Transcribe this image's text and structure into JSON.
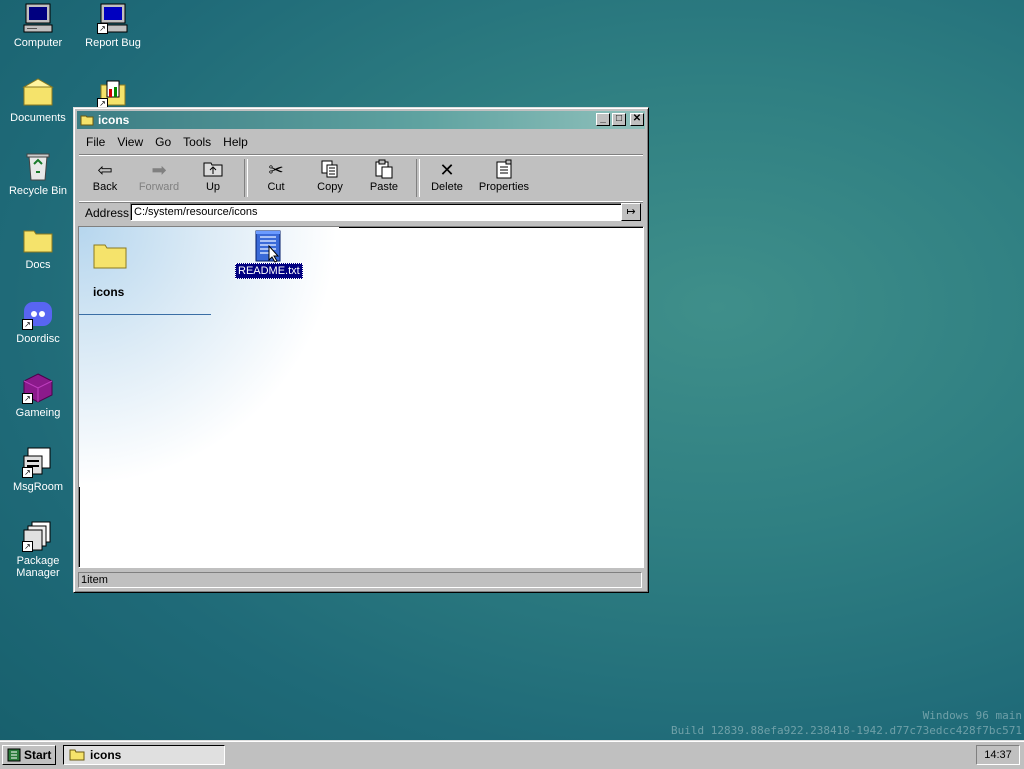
{
  "desktop": {
    "icons": [
      {
        "label": "Computer",
        "icon": "computer-icon"
      },
      {
        "label": "Report Bug",
        "icon": "report-bug-icon"
      },
      {
        "label": "Documents",
        "icon": "documents-folder-icon"
      },
      {
        "label": "",
        "icon": "setup-program-icon"
      },
      {
        "label": "Recycle Bin",
        "icon": "recycle-bin-icon"
      },
      {
        "label": "Docs",
        "icon": "folder-icon"
      },
      {
        "label": "Doordisc",
        "icon": "doordisc-icon"
      },
      {
        "label": "Gameing",
        "icon": "gameing-icon"
      },
      {
        "label": "MsgRoom",
        "icon": "msgroom-icon"
      },
      {
        "label": "Package Manager",
        "icon": "package-manager-icon"
      }
    ]
  },
  "window": {
    "title": "icons",
    "controls": {
      "minimize": "_",
      "maximize": "□",
      "close": "✕"
    },
    "menu": [
      "File",
      "View",
      "Go",
      "Tools",
      "Help"
    ],
    "toolbar": {
      "back": "Back",
      "forward": "Forward",
      "up": "Up",
      "cut": "Cut",
      "copy": "Copy",
      "paste": "Paste",
      "delete": "Delete",
      "properties": "Properties"
    },
    "address": {
      "label": "Address",
      "value": "C:/system/resource/icons"
    },
    "side_panel": {
      "title": "icons"
    },
    "files": [
      {
        "name": "README.txt",
        "icon": "text-file-icon",
        "selected": true
      }
    ],
    "status": "1item"
  },
  "taskbar": {
    "start_label": "Start",
    "task_label": "icons",
    "clock": "14:37"
  },
  "watermark": {
    "line1": "Windows 96 main",
    "line2": "Build 12839.88efa922.238418-1942.d77c73edcc428f7bc571"
  },
  "colors": {
    "selection": "#000080",
    "title_gradient_start": "#3c7d84",
    "title_gradient_end": "#8fc0bb",
    "face": "#c0c0c0"
  }
}
